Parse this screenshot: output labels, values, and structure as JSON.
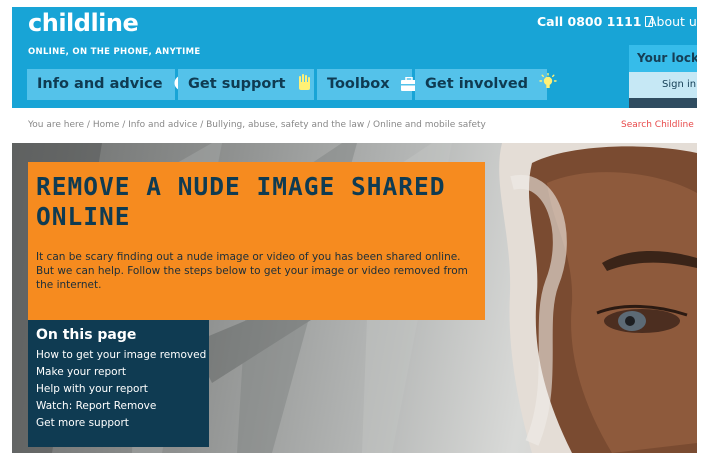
{
  "header": {
    "logo": "childline",
    "tagline": "ONLINE, ON THE PHONE, ANYTIME",
    "call": "Call 0800 1111",
    "about": "About us",
    "locker_title": "Your locker",
    "sign_in": "Sign in",
    "color_primary": "#18a4d6"
  },
  "nav": {
    "items": [
      {
        "label": "Info and advice",
        "icon": "info-icon"
      },
      {
        "label": "Get support",
        "icon": "hand-icon"
      },
      {
        "label": "Toolbox",
        "icon": "toolbox-icon"
      },
      {
        "label": "Get involved",
        "icon": "lightbulb-icon"
      }
    ]
  },
  "breadcrumb": {
    "text": "You are here / Home / Info and advice / Bullying, abuse, safety and the law / Online and mobile safety"
  },
  "search_link": "Search Childline",
  "hero": {
    "title": "REMOVE A NUDE IMAGE SHARED ONLINE",
    "intro": "It can be scary finding out a nude image or video of you has been shared online. But we can help. Follow the steps below to get your image or video removed from the internet.",
    "accent": "#f68b1f"
  },
  "toc": {
    "heading": "On this page",
    "links": [
      "How to get your image removed",
      "Make your report",
      "Help with your report",
      "Watch: Report Remove",
      "Get more support"
    ],
    "background": "#0f3b52"
  }
}
